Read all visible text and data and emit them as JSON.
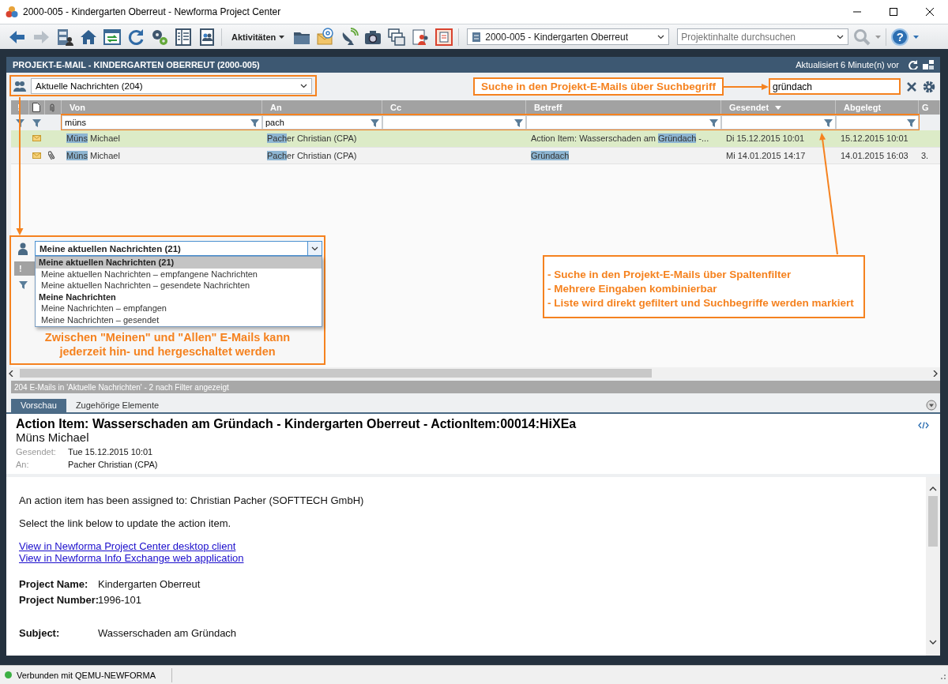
{
  "window": {
    "title": "2000-005 - Kindergarten Oberreut - Newforma Project Center"
  },
  "toolbar": {
    "activities_menu": "Aktivitäten",
    "project_selector": "2000-005 - Kindergarten Oberreut",
    "search": {
      "placeholder": "Projektinhalte durchsuchen"
    },
    "help_button": "?"
  },
  "panel": {
    "title": "PROJEKT-E-MAIL - KINDERGARTEN OBERREUT (2000-005)",
    "updated": "Aktualisiert 6 Minute(n) vor"
  },
  "view_selector": {
    "value": "Aktuelle Nachrichten (204)"
  },
  "search_callout": "Suche in den Projekt-E-Mails über Suchbegriff",
  "search_field": {
    "value": "gründach"
  },
  "table": {
    "importance_header": "!",
    "columns": [
      {
        "label": "Von",
        "sorted": false,
        "filterable": true,
        "filter": "müns"
      },
      {
        "label": "An",
        "sorted": false,
        "filterable": true,
        "filter": "pach"
      },
      {
        "label": "Cc",
        "sorted": false,
        "filterable": true
      },
      {
        "label": "Betreff",
        "sorted": false,
        "filterable": true
      },
      {
        "label": "Gesendet",
        "sorted": true,
        "filterable": true
      },
      {
        "label": "Abgelegt",
        "sorted": false,
        "filterable": true
      },
      {
        "label": "G",
        "sorted": false,
        "filterable": false
      }
    ],
    "rows": [
      {
        "selected": true,
        "attachment": false,
        "from": [
          {
            "text": "Müns",
            "highlight": true
          },
          {
            "text": " Michael",
            "highlight": false
          }
        ],
        "to": [
          {
            "text": "Pach",
            "highlight": true
          },
          {
            "text": "er Christian (CPA)",
            "highlight": false
          }
        ],
        "subject": [
          {
            "text": "Action Item: Wasserschaden am ",
            "highlight": false
          },
          {
            "text": "Gründach",
            "highlight": true
          },
          {
            "text": " -...",
            "highlight": false
          }
        ],
        "sent": [
          {
            "text": "Di 15.12.2015 10:01",
            "highlight": false
          }
        ],
        "filed": [
          {
            "text": "15.12.2015 10:01",
            "highlight": false
          }
        ]
      },
      {
        "selected": false,
        "attachment": true,
        "from": [
          {
            "text": "Müns",
            "highlight": true
          },
          {
            "text": " Michael",
            "highlight": false
          }
        ],
        "to": [
          {
            "text": "Pach",
            "highlight": true
          },
          {
            "text": "er Christian (CPA)",
            "highlight": false
          }
        ],
        "subject": [
          {
            "text": "Gründach",
            "highlight": true
          }
        ],
        "sent": [
          {
            "text": "Mi 14.01.2015 14:17",
            "highlight": false
          }
        ],
        "filed": [
          {
            "text": "14.01.2015 16:03",
            "highlight": false
          }
        ],
        "column_g": [
          {
            "text": "3.",
            "highlight": false
          }
        ]
      }
    ]
  },
  "my_views_callout": {
    "importance_header": "!",
    "selector": "Meine aktuellen Nachrichten (21)",
    "options": [
      {
        "label": "Meine aktuellen Nachrichten (21)",
        "kind": "group",
        "selected": true
      },
      {
        "label": "Meine aktuellen Nachrichten – empfangene Nachrichten",
        "kind": "item",
        "selected": false
      },
      {
        "label": "Meine aktuellen Nachrichten – gesendete Nachrichten",
        "kind": "item",
        "selected": false
      },
      {
        "label": "Meine Nachrichten",
        "kind": "group",
        "selected": false
      },
      {
        "label": "Meine Nachrichten – empfangen",
        "kind": "item",
        "selected": false
      },
      {
        "label": "Meine Nachrichten – gesendet",
        "kind": "item",
        "selected": false
      }
    ],
    "caption": "Zwischen \"Meinen\" und \"Allen\" E-Mails kann jederzeit hin- und hergeschaltet werden"
  },
  "filter_callout": [
    "- Suche in den Projekt-E-Mails über Spaltenfilter",
    "- Mehrere Eingaben kombinierbar",
    "- Liste wird direkt gefiltert und Suchbegriffe werden markiert"
  ],
  "list_status": "204 E-Mails in 'Aktuelle Nachrichten' - 2 nach Filter angezeigt",
  "tabs": [
    {
      "label": "Vorschau",
      "selected": true
    },
    {
      "label": "Zugehörige Elemente",
      "selected": false
    }
  ],
  "preview": {
    "subject": "Action Item: Wasserschaden am Gründach - Kindergarten Oberreut - ActionItem:00014:HiXEa",
    "sender": "Müns Michael",
    "fields": [
      {
        "label": "Gesendet:",
        "value": "Tue 15.12.2015 10:01"
      },
      {
        "label": "An:",
        "value": "Pacher Christian (CPA)"
      }
    ],
    "body": {
      "paragraphs": [
        "An action item has been assigned to: Christian Pacher (SOFTTECH GmbH)",
        "Select the link below to update the action item."
      ],
      "links": [
        "View in Newforma Project Center desktop client",
        "View in Newforma Info Exchange web application"
      ],
      "details": [
        [
          {
            "label": "Project Name:",
            "value": "Kindergarten Oberreut"
          },
          {
            "label": "Project Number:",
            "value": "1996-101"
          }
        ],
        [
          {
            "label": "Subject:",
            "value": "Wasserschaden am Gründach"
          }
        ]
      ]
    }
  },
  "status_bar": {
    "text": "Verbunden mit QEMU-NEWFORMA",
    "connected": true
  }
}
